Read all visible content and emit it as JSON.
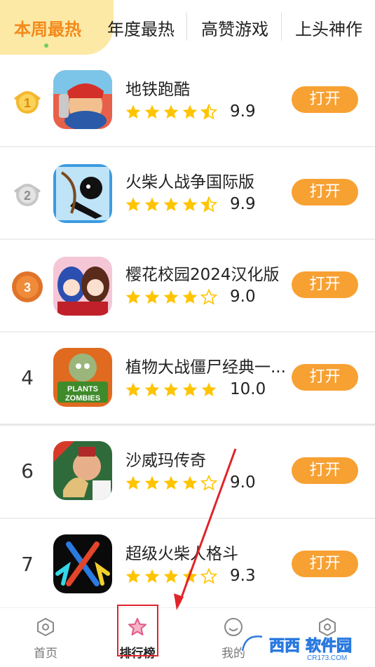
{
  "tabs": [
    {
      "label": "本周最热",
      "active": true
    },
    {
      "label": "年度最热",
      "active": false
    },
    {
      "label": "高赞游戏",
      "active": false
    },
    {
      "label": "上头神作",
      "active": false
    }
  ],
  "apps": [
    {
      "rank": "1",
      "medal": "gold",
      "name": "地铁跑酷",
      "stars": 4.5,
      "score": "9.9",
      "button": "打开",
      "icon": "subway-surfers-icon"
    },
    {
      "rank": "2",
      "medal": "silver",
      "name": "火柴人战争国际版",
      "stars": 4.5,
      "score": "9.9",
      "button": "打开",
      "icon": "stick-war-icon"
    },
    {
      "rank": "3",
      "medal": "bronze",
      "name": "樱花校园2024汉化版",
      "stars": 4,
      "score": "9.0",
      "button": "打开",
      "icon": "sakura-school-icon"
    },
    {
      "rank": "4",
      "medal": "",
      "name": "植物大战僵尸经典一...",
      "stars": 5,
      "score": "10.0",
      "button": "打开",
      "icon": "plants-vs-zombies-icon"
    },
    {
      "rank": "6",
      "medal": "",
      "name": "沙威玛传奇",
      "stars": 4,
      "score": "9.0",
      "button": "打开",
      "icon": "shawarma-legend-icon"
    },
    {
      "rank": "7",
      "medal": "",
      "name": "超级火柴人格斗",
      "stars": 4,
      "score": "9.3",
      "button": "打开",
      "icon": "super-stickman-fight-icon"
    }
  ],
  "bottom_nav": [
    {
      "label": "首页",
      "active": false,
      "icon": "home-icon"
    },
    {
      "label": "排行榜",
      "active": true,
      "icon": "ranking-star-icon"
    },
    {
      "label": "我的",
      "active": false,
      "icon": "profile-icon"
    },
    {
      "label": "",
      "active": false,
      "icon": "settings-icon"
    }
  ],
  "watermark": {
    "text": "西西软件园",
    "sub": "CR173.COM"
  },
  "colors": {
    "accent": "#f7a133",
    "active_tab": "#f28a1c",
    "tab_bg": "#fde9a6",
    "star": "#ffc400",
    "highlight": "#e0242a"
  }
}
